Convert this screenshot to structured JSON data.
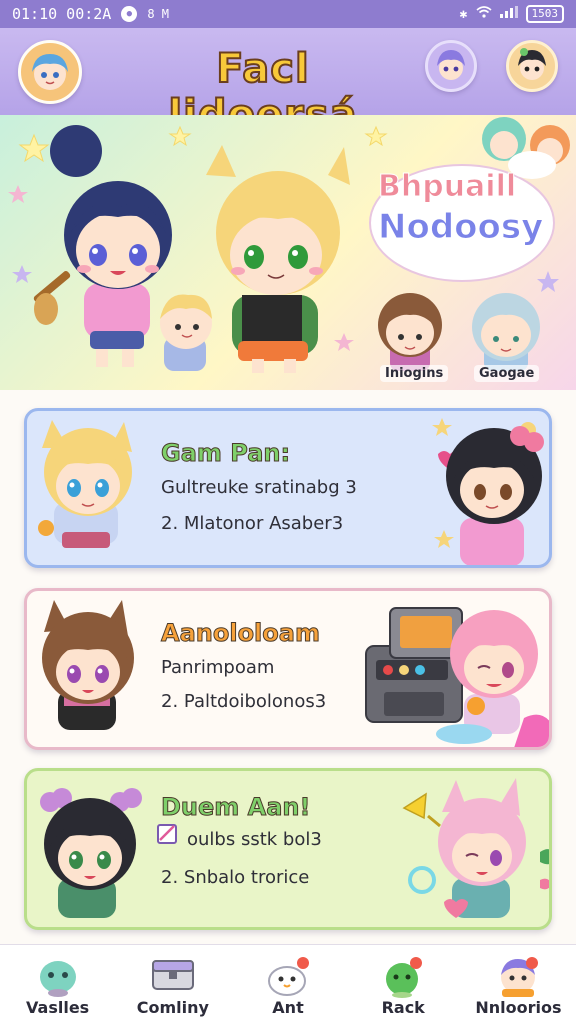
{
  "status_bar": {
    "time": "01:10 00:2A",
    "carrier": "8 M",
    "battery": "1503"
  },
  "header": {
    "title": "Facl lidoersá"
  },
  "hero": {
    "bubble_line1": "Bhpuaill",
    "bubble_line2": "Nodoosy",
    "char1_label": "Iniogins",
    "char2_label": "Gaogae"
  },
  "cards": [
    {
      "title": "Gam Pan:",
      "line1": "Gultreuke sratinabg 3",
      "line2": "2. Mlatonor Asaber3",
      "title_color": "#7fd06a",
      "bg": "#dbe6fb",
      "border": "#9bb7ee"
    },
    {
      "title": "Aanololoam",
      "line1": "Panrimpoam",
      "line2": "2. Paltdoibolonos3",
      "title_color": "#f6a13a",
      "bg": "#fffaf5",
      "border": "#e8b9c9"
    },
    {
      "title": "Duem Aan!",
      "line1": "oulbs sstk bol3",
      "line2": "2. Snbalo trorice",
      "title_color": "#7fd06a",
      "bg": "#e9f5c8",
      "border": "#b9de8a"
    }
  ],
  "tabs": [
    {
      "label": "Vaslles",
      "icon": "teal-creature-icon"
    },
    {
      "label": "Comliny",
      "icon": "treasure-box-icon"
    },
    {
      "label": "Ant",
      "icon": "cloud-ghost-icon"
    },
    {
      "label": "Rack",
      "icon": "green-blob-icon"
    },
    {
      "label": "Nnloorios",
      "icon": "character-face-icon"
    }
  ],
  "colors": {
    "status_bar": "#8e7ccf",
    "header": "#b5a3e8",
    "title_yellow": "#f8c93a"
  }
}
